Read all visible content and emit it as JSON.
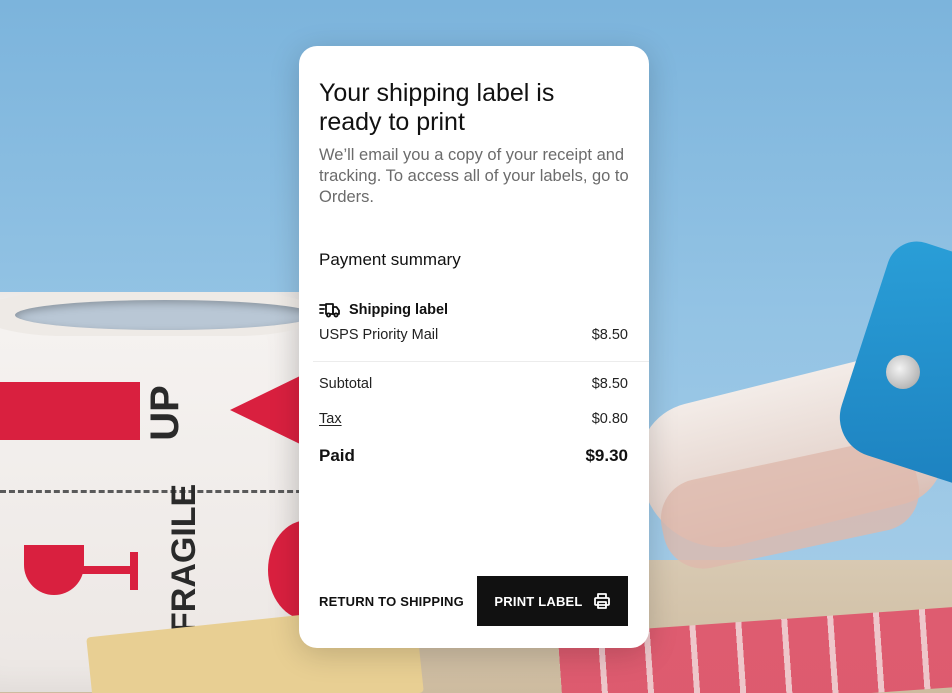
{
  "modal": {
    "title": "Your shipping label is ready to print",
    "subtitle": "We’ll email you a copy of your receipt and tracking. To access all of your labels, go to Orders."
  },
  "summary": {
    "section_title": "Payment summary",
    "item_header": "Shipping label",
    "item_icon": "truck-icon",
    "line_item": {
      "label": "USPS Priority Mail",
      "amount": "$8.50"
    },
    "subtotal": {
      "label": "Subtotal",
      "amount": "$8.50"
    },
    "tax": {
      "label": "Tax",
      "amount": "$0.80"
    },
    "paid": {
      "label": "Paid",
      "amount": "$9.30"
    }
  },
  "actions": {
    "return_label": "RETURN TO SHIPPING",
    "print_label": "PRINT LABEL",
    "print_icon": "printer-icon"
  },
  "background": {
    "labels": [
      "UP",
      "FRAGILE"
    ]
  },
  "colors": {
    "button_bg": "#111111",
    "muted_text": "#6b6b6b",
    "backdrop_sky": "#8fc0e2",
    "tape_red": "#d9203f"
  }
}
